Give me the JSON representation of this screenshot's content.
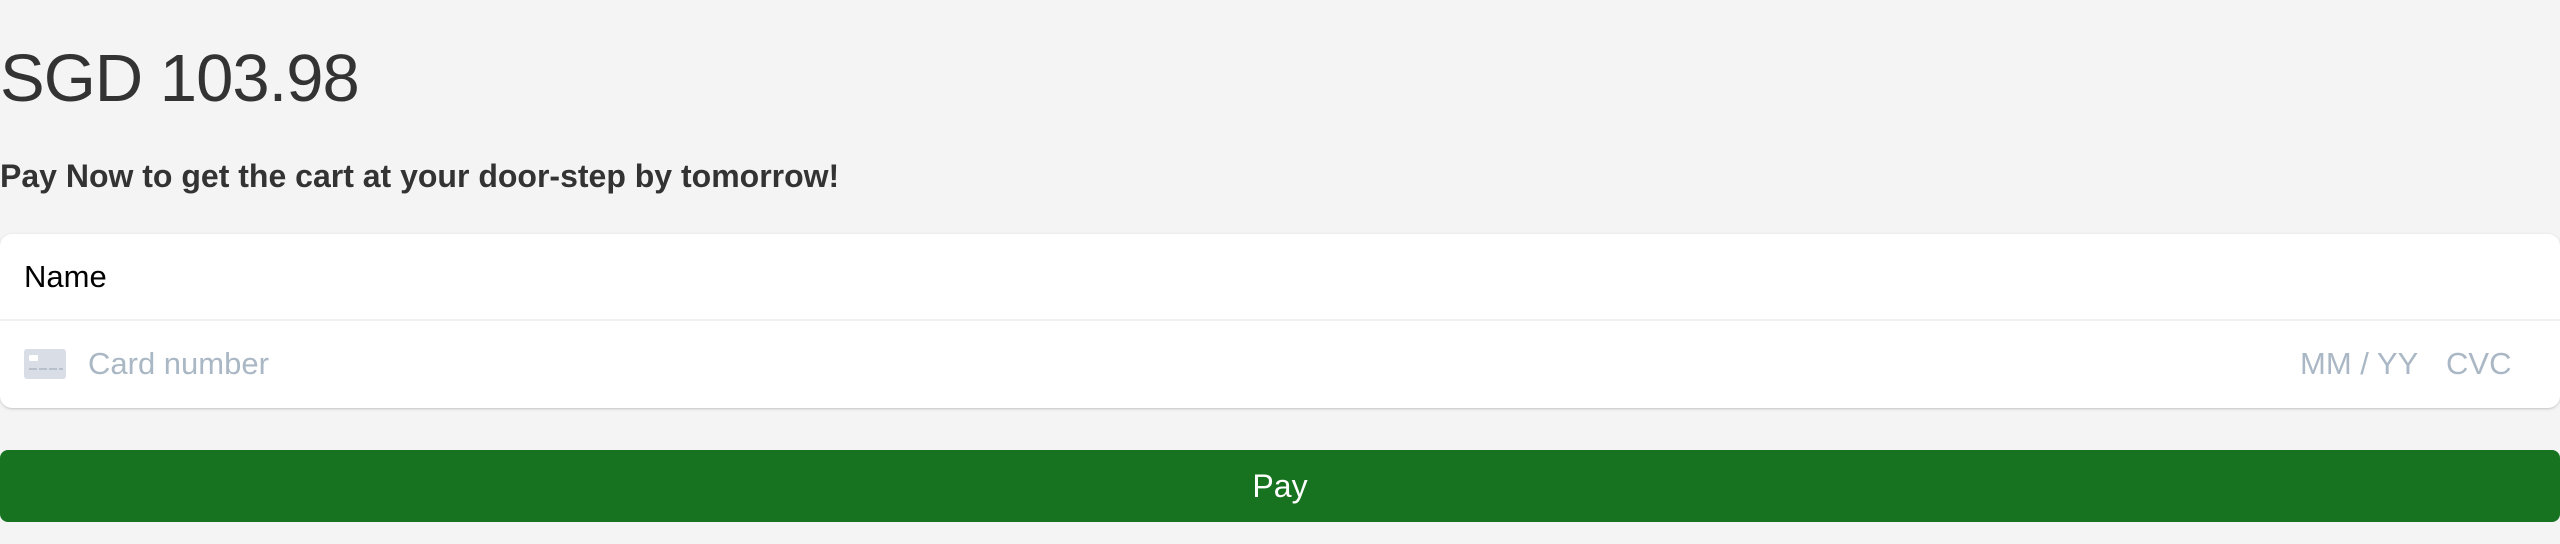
{
  "order": {
    "amount": "SGD 103.98",
    "tagline": "Pay Now to get the cart at your door-step by tomorrow!"
  },
  "payment_form": {
    "name_placeholder": "Name",
    "card_icon": "credit-card-icon",
    "card_number_placeholder": "Card number",
    "expiry_placeholder": "MM / YY",
    "cvc_placeholder": "CVC",
    "pay_label": "Pay"
  },
  "colors": {
    "background": "#f4f4f4",
    "text": "#333333",
    "placeholder": "#aab7c4",
    "pay_button": "#187321",
    "pay_button_text": "#ffffff"
  }
}
